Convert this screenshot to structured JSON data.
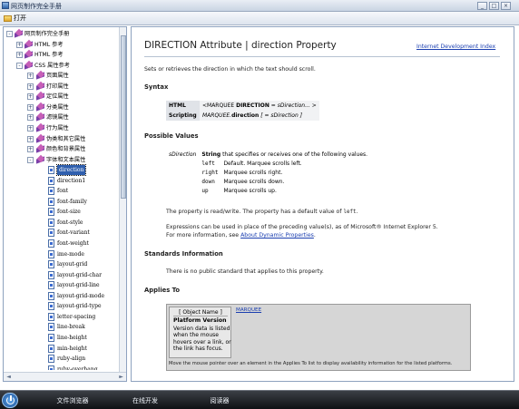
{
  "window": {
    "title": "网页制作完全手册",
    "buttons": [
      "_",
      "□",
      "×"
    ]
  },
  "toolbar": {
    "open_label": "打开"
  },
  "tree": {
    "root": "网页制作完全手册",
    "level1": [
      "HTML 参考",
      "HTML 参考",
      "CSS 属性参考"
    ],
    "css_children": [
      "页面属性",
      "打印属性",
      "定位属性",
      "分类属性",
      "滤镜属性",
      "行为属性",
      "伪类和其它属性",
      "颜色和背景属性",
      "字体和文本属性"
    ],
    "text_children": [
      "direction",
      "direction1",
      "font",
      "font-family",
      "font-size",
      "font-style",
      "font-variant",
      "font-weight",
      "ime-mode",
      "layout-grid",
      "layout-grid-char",
      "layout-grid-line",
      "layout-grid-mode",
      "layout-grid-type",
      "letter-spacing",
      "line-break",
      "line-height",
      "min-height",
      "ruby-align",
      "ruby-overhang"
    ],
    "selected": "direction"
  },
  "doc": {
    "title": "DIRECTION Attribute | direction Property",
    "index_link": "Internet Development Index",
    "summary": "Sets or retrieves the direction in which the text should scroll.",
    "syntax_heading": "Syntax",
    "syntax_rows": [
      {
        "head": "HTML",
        "body_pre": "<MARQUEE ",
        "body_key": "DIRECTION",
        "body_mid": " = ",
        "body_italic": "sDirection...",
        "body_post": " >"
      },
      {
        "head": "Scripting",
        "body_pre": "",
        "body_key": "MARQUEE.",
        "body_mid": "direction",
        "body_italic": " [ = sDirection ]",
        "body_post": ""
      }
    ],
    "possible_heading": "Possible Values",
    "pv_param": "sDirection",
    "pv_type": "String",
    "pv_desc": " that specifies or receives one of the following values.",
    "pv_values": [
      {
        "code": "left",
        "desc": "Default. Marquee scrolls left."
      },
      {
        "code": "right",
        "desc": "Marquee scrolls right."
      },
      {
        "code": "down",
        "desc": "Marquee scrolls down."
      },
      {
        "code": "up",
        "desc": "Marquee scrolls up."
      }
    ],
    "default_note_pre": "The property is read/write. The property has a default value of ",
    "default_note_code": "left",
    "default_note_post": ".",
    "expr_note_1": "Expressions can be used in place of the preceding value(s), as of Microsoft® Internet Explorer 5.",
    "expr_note_2_pre": "For more information, see ",
    "expr_note_link": "About Dynamic Properties",
    "expr_note_2_post": ".",
    "standards_heading": "Standards Information",
    "standards_text": "There is no public standard that applies to this property.",
    "applies_heading": "Applies To",
    "applies_objname": "[ Object Name ]",
    "applies_pv": "Platform Version",
    "applies_pvdesc": "Version data is listed when the mouse hovers over a link, or the link has focus.",
    "applies_marquee": "MARQUEE",
    "applies_footer": "Move the mouse pointer over an element in the Applies To list to display availability information for the listed platforms."
  },
  "taskbar": {
    "buttons": [
      "文件浏览器",
      "在线开发",
      "阅读器"
    ]
  }
}
